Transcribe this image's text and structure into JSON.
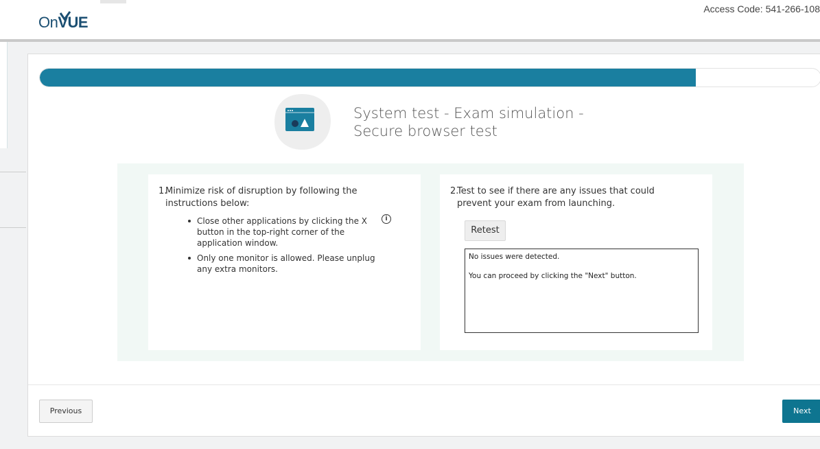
{
  "header": {
    "logo_on": "On",
    "logo_vue": "VUE",
    "access_code_label": "Access Code: 541-266-108"
  },
  "progress": {
    "value": 0.84
  },
  "page": {
    "title_line1": "System test - Exam simulation -",
    "title_line2": "Secure browser test"
  },
  "step1": {
    "number": "1.",
    "heading": "Minimize risk of disruption by following the instructions below:",
    "bullets": [
      "Close other applications by clicking the X button in the top-right corner of the application window.",
      "Only one monitor is allowed. Please unplug any extra monitors."
    ],
    "info_icon": "i"
  },
  "step2": {
    "number": "2.",
    "heading": "Test to see if there are any issues that could prevent your exam from launching.",
    "retest_label": "Retest",
    "result_line1": "No issues were detected.",
    "result_line2": "You can proceed by clicking the \"Next\" button."
  },
  "footer": {
    "previous_label": "Previous",
    "next_label": "Next"
  },
  "colors": {
    "accent": "#1a7fa0",
    "next_button": "#0e7590",
    "panel_bg": "#f1f8f5"
  }
}
